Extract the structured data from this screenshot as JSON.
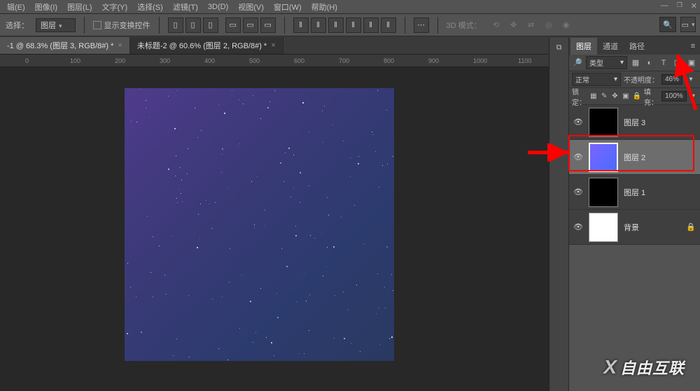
{
  "menu": {
    "items": [
      "辑(E)",
      "图像(I)",
      "图层(L)",
      "文字(Y)",
      "选择(S)",
      "滤镜(T)",
      "3D(D)",
      "视图(V)",
      "窗口(W)",
      "帮助(H)"
    ]
  },
  "options_bar": {
    "select_label": "选择：",
    "select_value": "图层",
    "show_transform_label": "显示变换控件",
    "mode3d_label": "3D 模式："
  },
  "tabs": [
    {
      "label": "-1 @ 68.3% (图层 3, RGB/8#) *"
    },
    {
      "label": "未标题-2 @ 60.6% (图层 2, RGB/8#) *"
    }
  ],
  "ruler_marks": [
    "0",
    "100",
    "200",
    "300",
    "400",
    "500",
    "600",
    "700",
    "800",
    "900",
    "1000",
    "1100"
  ],
  "layers_panel": {
    "tab_layers": "图层",
    "tab_channels": "通道",
    "tab_paths": "路径",
    "filter_label": "类型",
    "blend_mode": "正常",
    "opacity_label": "不透明度：",
    "opacity_value": "46%",
    "lock_label": "锁定：",
    "fill_label": "填充：",
    "fill_value": "100%",
    "layers": [
      {
        "name": "图层 3",
        "visible": true,
        "thumb": "black"
      },
      {
        "name": "图层 2",
        "visible": true,
        "thumb": "gradient",
        "selected": true
      },
      {
        "name": "图层 1",
        "visible": true,
        "thumb": "black"
      },
      {
        "name": "背景",
        "visible": true,
        "thumb": "white",
        "locked": true
      }
    ]
  },
  "watermark": "自由互联"
}
